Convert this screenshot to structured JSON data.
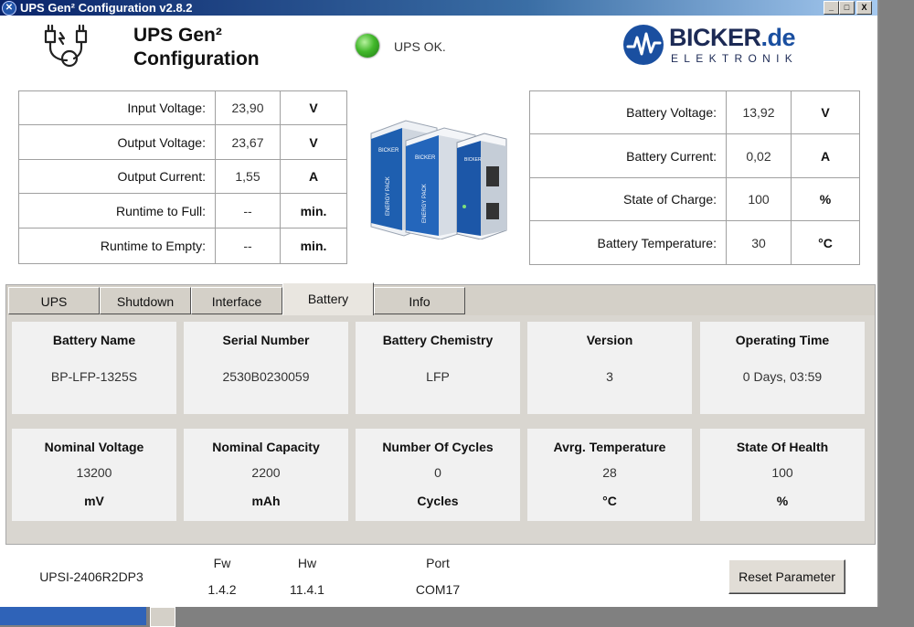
{
  "window": {
    "title": "UPS Gen² Configuration v2.8.2",
    "controls": {
      "minimize": "_",
      "maximize": "□",
      "close": "X"
    }
  },
  "header": {
    "title_line1": "UPS Gen²",
    "title_line2": "Configuration",
    "status_text": "UPS OK.",
    "status_color": "#43b82c",
    "logo_brand": "BICKER",
    "logo_suffix": ".de",
    "logo_sub": "ELEKTRONIK"
  },
  "left_measurements": [
    {
      "label": "Input Voltage:",
      "value": "23,90",
      "unit": "V"
    },
    {
      "label": "Output Voltage:",
      "value": "23,67",
      "unit": "V"
    },
    {
      "label": "Output Current:",
      "value": "1,55",
      "unit": "A"
    },
    {
      "label": "Runtime to Full:",
      "value": "--",
      "unit": "min."
    },
    {
      "label": "Runtime to Empty:",
      "value": "--",
      "unit": "min."
    }
  ],
  "right_measurements": [
    {
      "label": "Battery Voltage:",
      "value": "13,92",
      "unit": "V"
    },
    {
      "label": "Battery Current:",
      "value": "0,02",
      "unit": "A"
    },
    {
      "label": "State of Charge:",
      "value": "100",
      "unit": "%"
    },
    {
      "label": "Battery Temperature:",
      "value": "30",
      "unit": "°C"
    }
  ],
  "tabs": [
    {
      "label": "UPS"
    },
    {
      "label": "Shutdown"
    },
    {
      "label": "Interface"
    },
    {
      "label": "Battery",
      "active": true
    },
    {
      "label": "Info"
    }
  ],
  "battery_cards_row1": [
    {
      "heading": "Battery Name",
      "value": "BP-LFP-1325S"
    },
    {
      "heading": "Serial Number",
      "value": "2530B0230059"
    },
    {
      "heading": "Battery Chemistry",
      "value": "LFP"
    },
    {
      "heading": "Version",
      "value": "3"
    },
    {
      "heading": "Operating Time",
      "value": "0 Days, 03:59"
    }
  ],
  "battery_cards_row2": [
    {
      "heading": "Nominal Voltage",
      "value": "13200",
      "unit": "mV"
    },
    {
      "heading": "Nominal Capacity",
      "value": "2200",
      "unit": "mAh"
    },
    {
      "heading": "Number Of Cycles",
      "value": "0",
      "unit": "Cycles"
    },
    {
      "heading": "Avrg. Temperature",
      "value": "28",
      "unit": "°C"
    },
    {
      "heading": "State Of Health",
      "value": "100",
      "unit": "%"
    }
  ],
  "footer": {
    "model": "UPSI-2406R2DP3",
    "fw_label": "Fw",
    "fw_value": "1.4.2",
    "hw_label": "Hw",
    "hw_value": "11.4.1",
    "port_label": "Port",
    "port_value": "COM17",
    "reset_label": "Reset Parameter"
  },
  "colors": {
    "accent": "#1a4fa0",
    "titlebar": "#0a246a",
    "panel": "#d4d0c8"
  },
  "icons": {
    "app": "bicker-app-icon",
    "header": "battery-plug-cable-icon",
    "led": "status-led-icon"
  }
}
